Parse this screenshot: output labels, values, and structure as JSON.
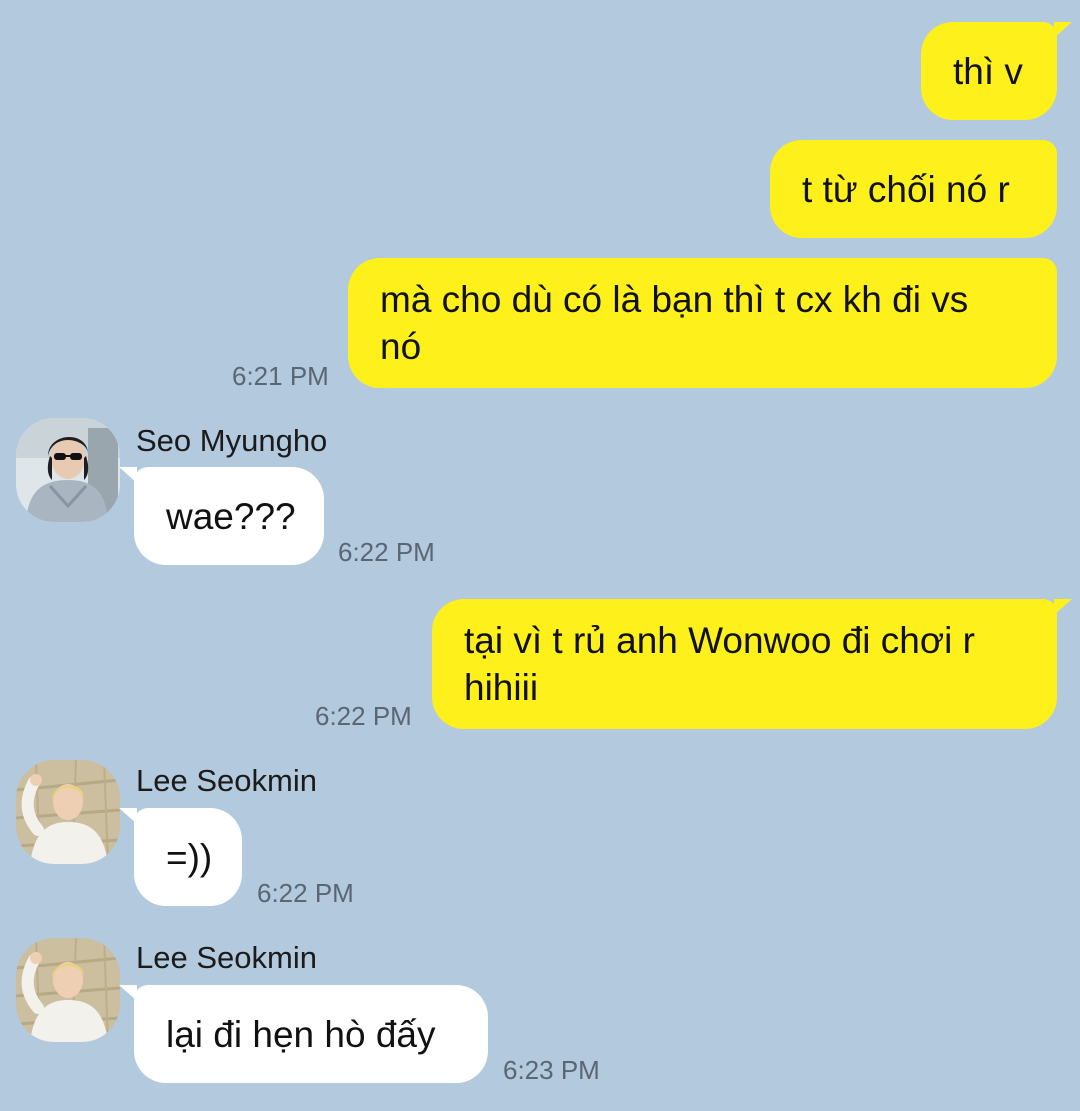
{
  "chat": {
    "messages": [
      {
        "direction": "outgoing",
        "text": "thì v"
      },
      {
        "direction": "outgoing",
        "text": "t từ chối nó r"
      },
      {
        "direction": "outgoing",
        "text": "mà cho dù có là bạn thì t cx kh đi vs\nnó",
        "time": "6:21 PM"
      },
      {
        "direction": "incoming",
        "sender": "Seo Myungho",
        "avatar_icon": "profile-photo-icon",
        "text": "wae???",
        "time": "6:22 PM"
      },
      {
        "direction": "outgoing",
        "text": "tại vì t rủ anh Wonwoo đi chơi r\nhihiii",
        "time": "6:22 PM"
      },
      {
        "direction": "incoming",
        "sender": "Lee Seokmin",
        "avatar_icon": "profile-photo-icon",
        "text": "=))",
        "time": "6:22 PM"
      },
      {
        "direction": "incoming",
        "sender": "Lee Seokmin",
        "avatar_icon": "profile-photo-icon",
        "text": "lại đi hẹn hò đấy",
        "time": "6:23 PM"
      }
    ]
  },
  "colors": {
    "background": "#b3c9de",
    "outgoing_bubble": "#fef01b",
    "incoming_bubble": "#ffffff",
    "timestamp": "#5a6673"
  }
}
